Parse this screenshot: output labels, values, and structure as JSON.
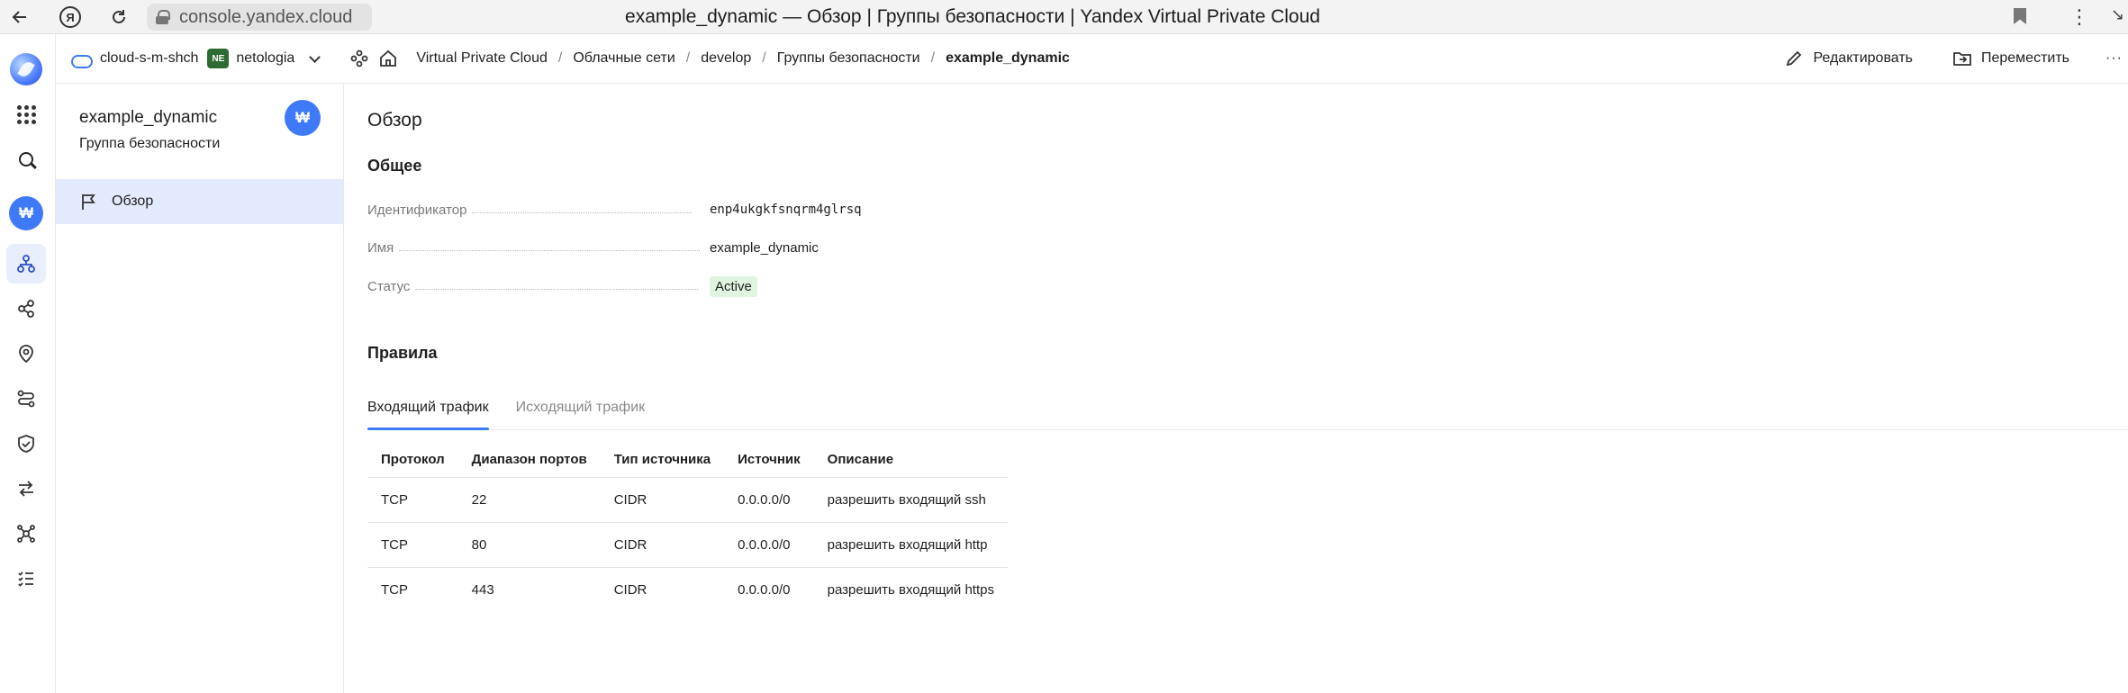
{
  "browser": {
    "url": "console.yandex.cloud",
    "page_title": "example_dynamic — Обзор | Группы безопасности | Yandex Virtual Private Cloud",
    "ya_label": "Я"
  },
  "topbar": {
    "cloud_name": "cloud-s-m-shch",
    "folder_badge": "NE",
    "folder_name": "netologia",
    "breadcrumbs": [
      "Virtual Private Cloud",
      "Облачные сети",
      "develop",
      "Группы безопасности",
      "example_dynamic"
    ],
    "edit_label": "Редактировать",
    "move_label": "Переместить",
    "more_label": "···"
  },
  "sidebar": {
    "resource_title": "example_dynamic",
    "resource_type": "Группа безопасности",
    "badge_glyph": "₩",
    "menu": [
      {
        "label": "Обзор",
        "icon": "flag-icon"
      }
    ]
  },
  "main": {
    "page_title": "Обзор",
    "general_title": "Общее",
    "fields": [
      {
        "key": "Идентификатор",
        "value": "enp4ukgkfsnqrm4glrsq"
      },
      {
        "key": "Имя",
        "value": "example_dynamic"
      },
      {
        "key": "Статус",
        "value": "Active"
      }
    ],
    "rules_title": "Правила",
    "tabs": [
      {
        "label": "Входящий трафик",
        "active": true
      },
      {
        "label": "Исходящий трафик",
        "active": false
      }
    ],
    "table": {
      "headers": [
        "Протокол",
        "Диапазон портов",
        "Тип источника",
        "Источник",
        "Описание"
      ],
      "rows": [
        [
          "TCP",
          "22",
          "CIDR",
          "0.0.0.0/0",
          "разрешить входящий ssh"
        ],
        [
          "TCP",
          "80",
          "CIDR",
          "0.0.0.0/0",
          "разрешить входящий http"
        ],
        [
          "TCP",
          "443",
          "CIDR",
          "0.0.0.0/0",
          "разрешить входящий https"
        ]
      ]
    }
  },
  "colors": {
    "accent": "#3e7af8",
    "status_active_bg": "#dff5e0",
    "status_active_text": "#2f9e44",
    "menu_active_bg": "#e3eafd"
  }
}
